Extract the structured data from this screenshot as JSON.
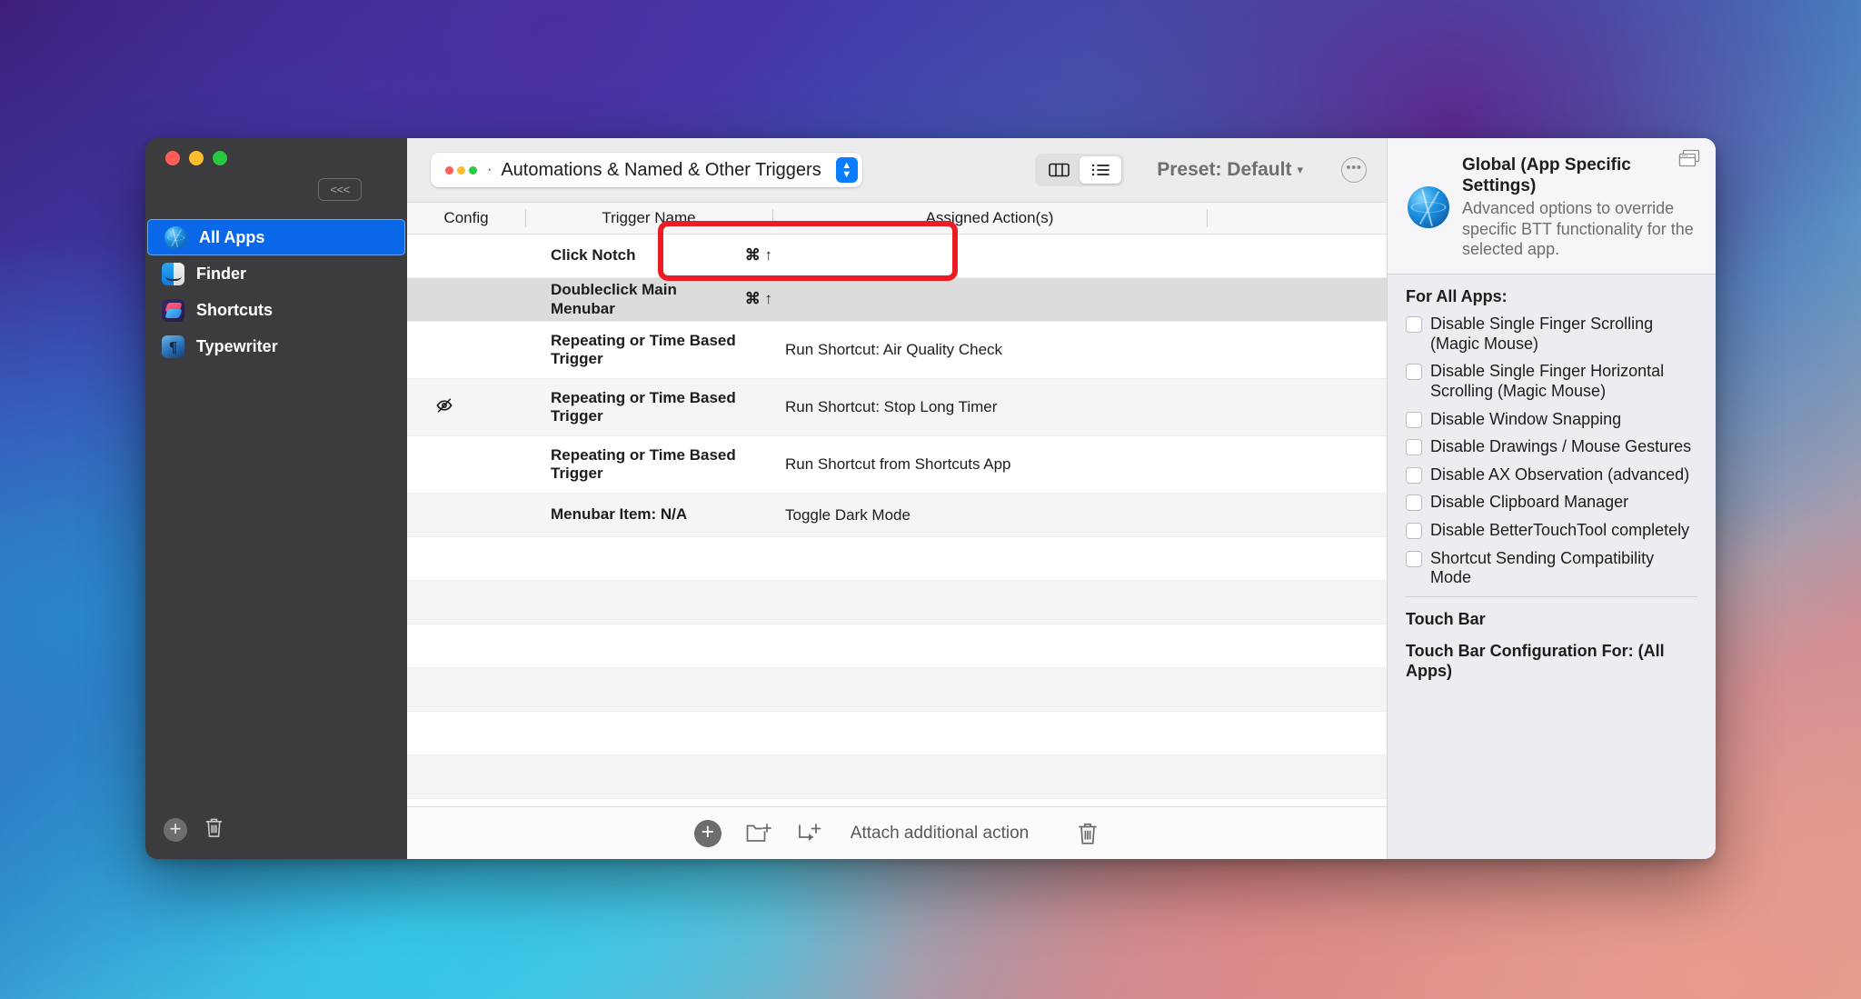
{
  "window": {
    "traffic_lights": [
      "close",
      "minimize",
      "zoom"
    ],
    "collapse_label": "<<<"
  },
  "sidebar": {
    "items": [
      {
        "label": "All Apps",
        "icon": "globe-icon",
        "selected": true
      },
      {
        "label": "Finder",
        "icon": "finder-icon",
        "selected": false
      },
      {
        "label": "Shortcuts",
        "icon": "shortcuts-icon",
        "selected": false
      },
      {
        "label": "Typewriter",
        "icon": "typewriter-icon",
        "selected": false
      }
    ],
    "add_button": "+",
    "delete_button": "trash-icon"
  },
  "toolbar": {
    "category_bullet": "·",
    "category_label": "Automations & Named & Other Triggers",
    "view_column_icon": "column-view-icon",
    "view_list_icon": "list-view-icon",
    "preset_label": "Preset: Default",
    "preset_caret": "▾",
    "more_label": "•••"
  },
  "table": {
    "columns": [
      "Config",
      "Trigger Name",
      "Assigned Action(s)",
      ""
    ],
    "rows": [
      {
        "config": "",
        "trigger": "Click Notch",
        "shortcut": "⌘ ↑",
        "action": "",
        "style": "white",
        "highlighted": true
      },
      {
        "config": "",
        "trigger": "Doubleclick Main Menubar",
        "shortcut": "⌘ ↑",
        "action": "",
        "style": "selected",
        "highlighted": true
      },
      {
        "config": "",
        "trigger": "Repeating or Time Based Trigger",
        "shortcut": "",
        "action": "Run Shortcut: Air Quality Check",
        "style": "white",
        "highlighted": false
      },
      {
        "config": "hidden-eye-icon",
        "trigger": "Repeating or Time Based Trigger",
        "shortcut": "",
        "action": "Run Shortcut: Stop Long Timer",
        "style": "alt",
        "highlighted": false
      },
      {
        "config": "",
        "trigger": "Repeating or Time Based Trigger",
        "shortcut": "",
        "action": "Run Shortcut from Shortcuts App",
        "style": "white",
        "highlighted": false
      },
      {
        "config": "",
        "trigger": "Menubar Item: N/A",
        "shortcut": "",
        "action": "Toggle Dark Mode",
        "style": "alt",
        "highlighted": false
      },
      {
        "config": "",
        "trigger": "",
        "shortcut": "",
        "action": "",
        "style": "white",
        "highlighted": false
      },
      {
        "config": "",
        "trigger": "",
        "shortcut": "",
        "action": "",
        "style": "alt",
        "highlighted": false
      },
      {
        "config": "",
        "trigger": "",
        "shortcut": "",
        "action": "",
        "style": "white",
        "highlighted": false
      },
      {
        "config": "",
        "trigger": "",
        "shortcut": "",
        "action": "",
        "style": "alt",
        "highlighted": false
      },
      {
        "config": "",
        "trigger": "",
        "shortcut": "",
        "action": "",
        "style": "white",
        "highlighted": false
      },
      {
        "config": "",
        "trigger": "",
        "shortcut": "",
        "action": "",
        "style": "alt",
        "highlighted": false
      }
    ]
  },
  "bottom_bar": {
    "add_trigger": "+",
    "new_folder_icon": "new-folder-icon",
    "attach_icon": "attach-action-icon",
    "attach_label": "Attach additional action",
    "delete_icon": "trash-icon"
  },
  "inspector": {
    "title": "Global (App Specific Settings)",
    "description": "Advanced options to override specific BTT functionality for the selected app.",
    "windows_icon": "windows-stack-icon",
    "section_header": "For All Apps:",
    "checkboxes": [
      {
        "label": "Disable Single Finger Scrolling (Magic Mouse)",
        "checked": false
      },
      {
        "label": "Disable Single Finger Horizontal Scrolling (Magic Mouse)",
        "checked": false
      },
      {
        "label": "Disable Window Snapping",
        "checked": false
      },
      {
        "label": "Disable Drawings / Mouse Gestures",
        "checked": false
      },
      {
        "label": "Disable AX Observation (advanced)",
        "checked": false
      },
      {
        "label": "Disable Clipboard Manager",
        "checked": false
      },
      {
        "label": "Disable BetterTouchTool completely",
        "checked": false
      },
      {
        "label": "Shortcut Sending Compatibility Mode",
        "checked": false
      }
    ],
    "touch_bar_title": "Touch Bar",
    "touch_bar_config": "Touch Bar Configuration For: (All Apps)"
  },
  "colors": {
    "accent_blue": "#0a68e8",
    "highlight_red": "#ed1c24",
    "selected_row": "#dcdcdc",
    "sidebar_bg": "#3c3c3e"
  }
}
